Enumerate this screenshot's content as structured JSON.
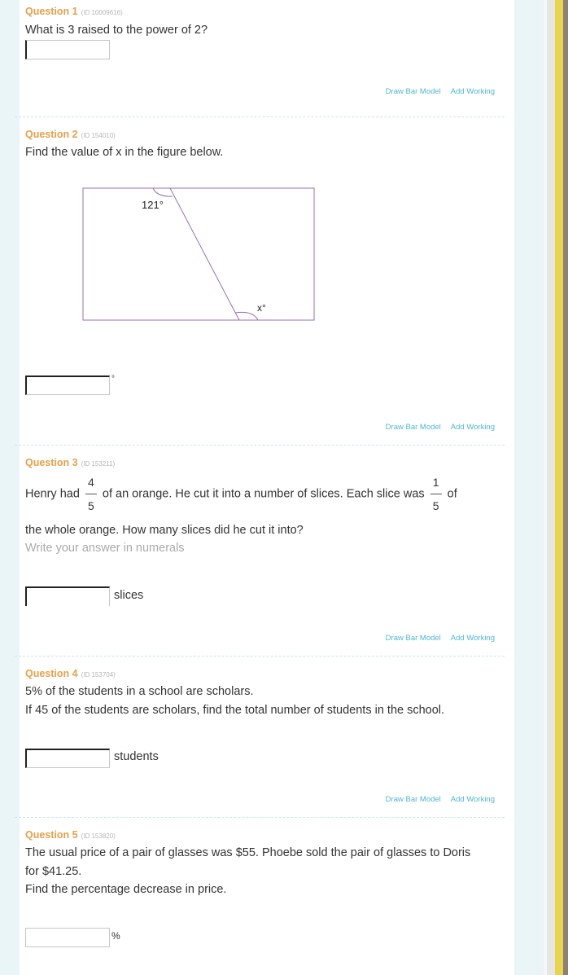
{
  "questions": [
    {
      "title": "Question 1",
      "id_label": "(ID 10009616)",
      "text": "What is 3 raised to the power of 2?",
      "answer_value": "",
      "unit": "",
      "links": [
        "Draw Bar Model",
        "Add Working"
      ]
    },
    {
      "title": "Question 2",
      "id_label": "(ID 154010)",
      "text": "Find the value of x in the figure below.",
      "figure": {
        "angle_top_label": "121°",
        "angle_bottom_label": "x°"
      },
      "answer_value": "",
      "unit": "°",
      "links": [
        "Draw Bar Model",
        "Add Working"
      ]
    },
    {
      "title": "Question 3",
      "id_label": "(ID 153211)",
      "text_part1": "Henry had",
      "fraction1": {
        "numerator": "4",
        "denominator": "5"
      },
      "text_part2": "of an orange. He cut it into a number of slices. Each slice was",
      "fraction2": {
        "numerator": "1",
        "denominator": "5"
      },
      "text_part3": "of",
      "text_line2": "the whole orange. How many slices did he cut it into?",
      "hint": "Write your answer in numerals",
      "answer_value": "",
      "unit": "slices",
      "links": [
        "Draw Bar Model",
        "Add Working"
      ]
    },
    {
      "title": "Question 4",
      "id_label": "(ID 153704)",
      "text_line1": "5% of the students in a school are scholars.",
      "text_line2": "If 45 of the students are scholars, find the total number of students in the school.",
      "answer_value": "",
      "unit": "students",
      "links": [
        "Draw Bar Model",
        "Add Working"
      ]
    },
    {
      "title": "Question 5",
      "id_label": "(ID 153820)",
      "text_line1": "The usual price of a pair of glasses was $55. Phoebe sold the pair of glasses to Doris",
      "text_line2": "for $41.25.",
      "text_line3": "Find the percentage decrease in price.",
      "answer_value": "",
      "unit": "%"
    }
  ],
  "colors": {
    "question_title": "#e8a04a",
    "link": "#4fb8d0",
    "page_bg": "#eaf5f8",
    "figure_line": "#9b6fb0"
  }
}
